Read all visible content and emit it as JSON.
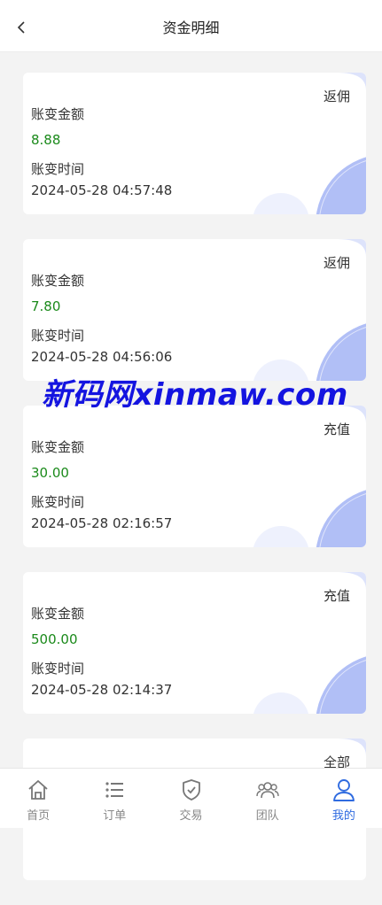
{
  "header": {
    "title": "资金明细"
  },
  "records": [
    {
      "type": "返佣",
      "amount_label": "账变金额",
      "amount": "8.88",
      "time_label": "账变时间",
      "time": "2024-05-28 04:57:48"
    },
    {
      "type": "返佣",
      "amount_label": "账变金额",
      "amount": "7.80",
      "time_label": "账变时间",
      "time": "2024-05-28 04:56:06"
    },
    {
      "type": "充值",
      "amount_label": "账变金额",
      "amount": "30.00",
      "time_label": "账变时间",
      "time": "2024-05-28 02:16:57"
    },
    {
      "type": "充值",
      "amount_label": "账变金额",
      "amount": "500.00",
      "time_label": "账变时间",
      "time": "2024-05-28 02:14:37"
    },
    {
      "type": "全部",
      "amount_label": "",
      "amount": "",
      "time_label": "",
      "time": ""
    }
  ],
  "watermark": "新码网xinmaw.com",
  "tabbar": [
    {
      "label": "首页",
      "icon": "home-icon",
      "active": false
    },
    {
      "label": "订单",
      "icon": "list-icon",
      "active": false
    },
    {
      "label": "交易",
      "icon": "shield-check-icon",
      "active": false
    },
    {
      "label": "团队",
      "icon": "team-icon",
      "active": false
    },
    {
      "label": "我的",
      "icon": "user-icon",
      "active": true
    }
  ],
  "colors": {
    "accent": "#2f6be0",
    "amount": "#1b8a1b",
    "deco": "#a9b8f5"
  }
}
